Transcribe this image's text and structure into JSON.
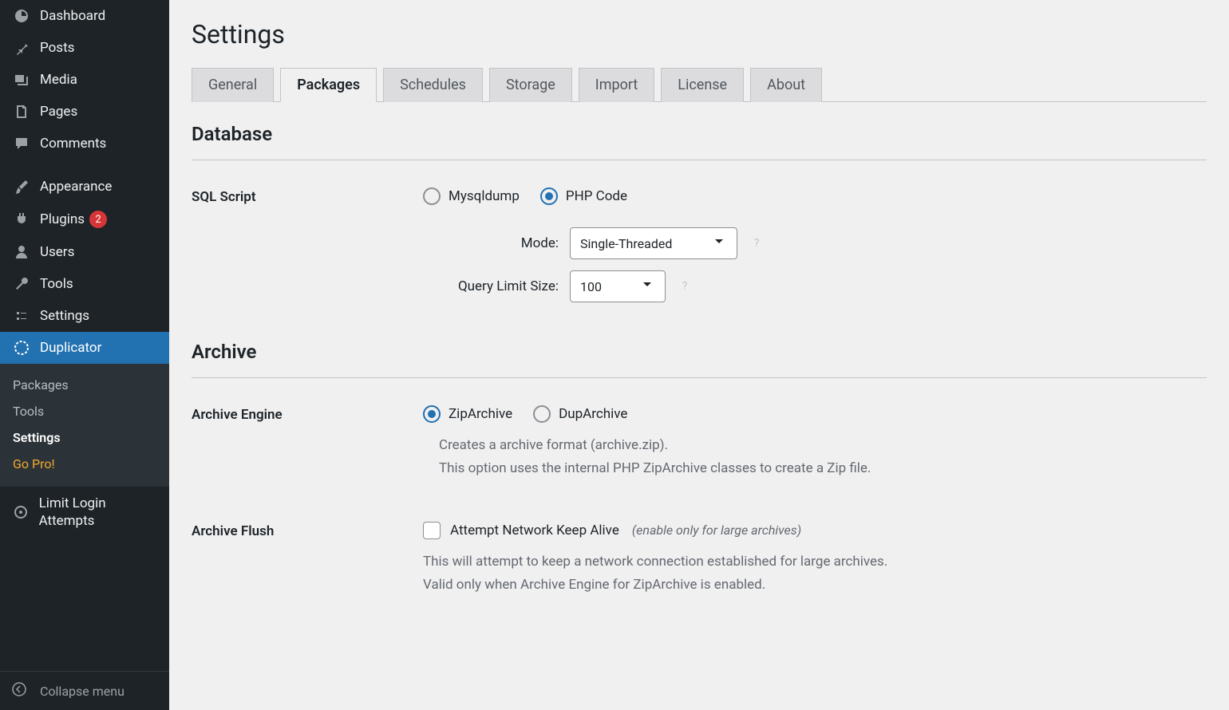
{
  "sidebar": {
    "items": [
      {
        "label": "Dashboard",
        "icon": "dashboard"
      },
      {
        "label": "Posts",
        "icon": "pin"
      },
      {
        "label": "Media",
        "icon": "media"
      },
      {
        "label": "Pages",
        "icon": "pages"
      },
      {
        "label": "Comments",
        "icon": "comments"
      },
      {
        "label": "Appearance",
        "icon": "brush"
      },
      {
        "label": "Plugins",
        "icon": "plugin",
        "badge": "2"
      },
      {
        "label": "Users",
        "icon": "user"
      },
      {
        "label": "Tools",
        "icon": "wrench"
      },
      {
        "label": "Settings",
        "icon": "settings"
      },
      {
        "label": "Duplicator",
        "icon": "duplicator",
        "active": true
      },
      {
        "label": "Limit Login Attempts",
        "icon": "limit"
      }
    ],
    "sub": [
      {
        "label": "Packages"
      },
      {
        "label": "Tools"
      },
      {
        "label": "Settings",
        "active": true
      },
      {
        "label": "Go Pro!",
        "pro": true
      }
    ],
    "collapse": "Collapse menu"
  },
  "main": {
    "title": "Settings",
    "tabs": [
      "General",
      "Packages",
      "Schedules",
      "Storage",
      "Import",
      "License",
      "About"
    ],
    "active_tab": 1,
    "sections": {
      "database": {
        "title": "Database",
        "sql_script": {
          "label": "SQL Script",
          "options": [
            "Mysqldump",
            "PHP Code"
          ],
          "selected": 1,
          "mode": {
            "label": "Mode:",
            "value": "Single-Threaded"
          },
          "query_limit": {
            "label": "Query Limit Size:",
            "value": "100"
          }
        }
      },
      "archive": {
        "title": "Archive",
        "engine": {
          "label": "Archive Engine",
          "options": [
            "ZipArchive",
            "DupArchive"
          ],
          "selected": 0,
          "desc1": "Creates a archive format (archive.zip).",
          "desc2": "This option uses the internal PHP ZipArchive classes to create a Zip file."
        },
        "flush": {
          "label": "Archive Flush",
          "checkbox_label": "Attempt Network Keep Alive",
          "hint": "(enable only for large archives)",
          "desc1": "This will attempt to keep a network connection established for large archives.",
          "desc2": "Valid only when Archive Engine for ZipArchive is enabled."
        }
      }
    }
  }
}
